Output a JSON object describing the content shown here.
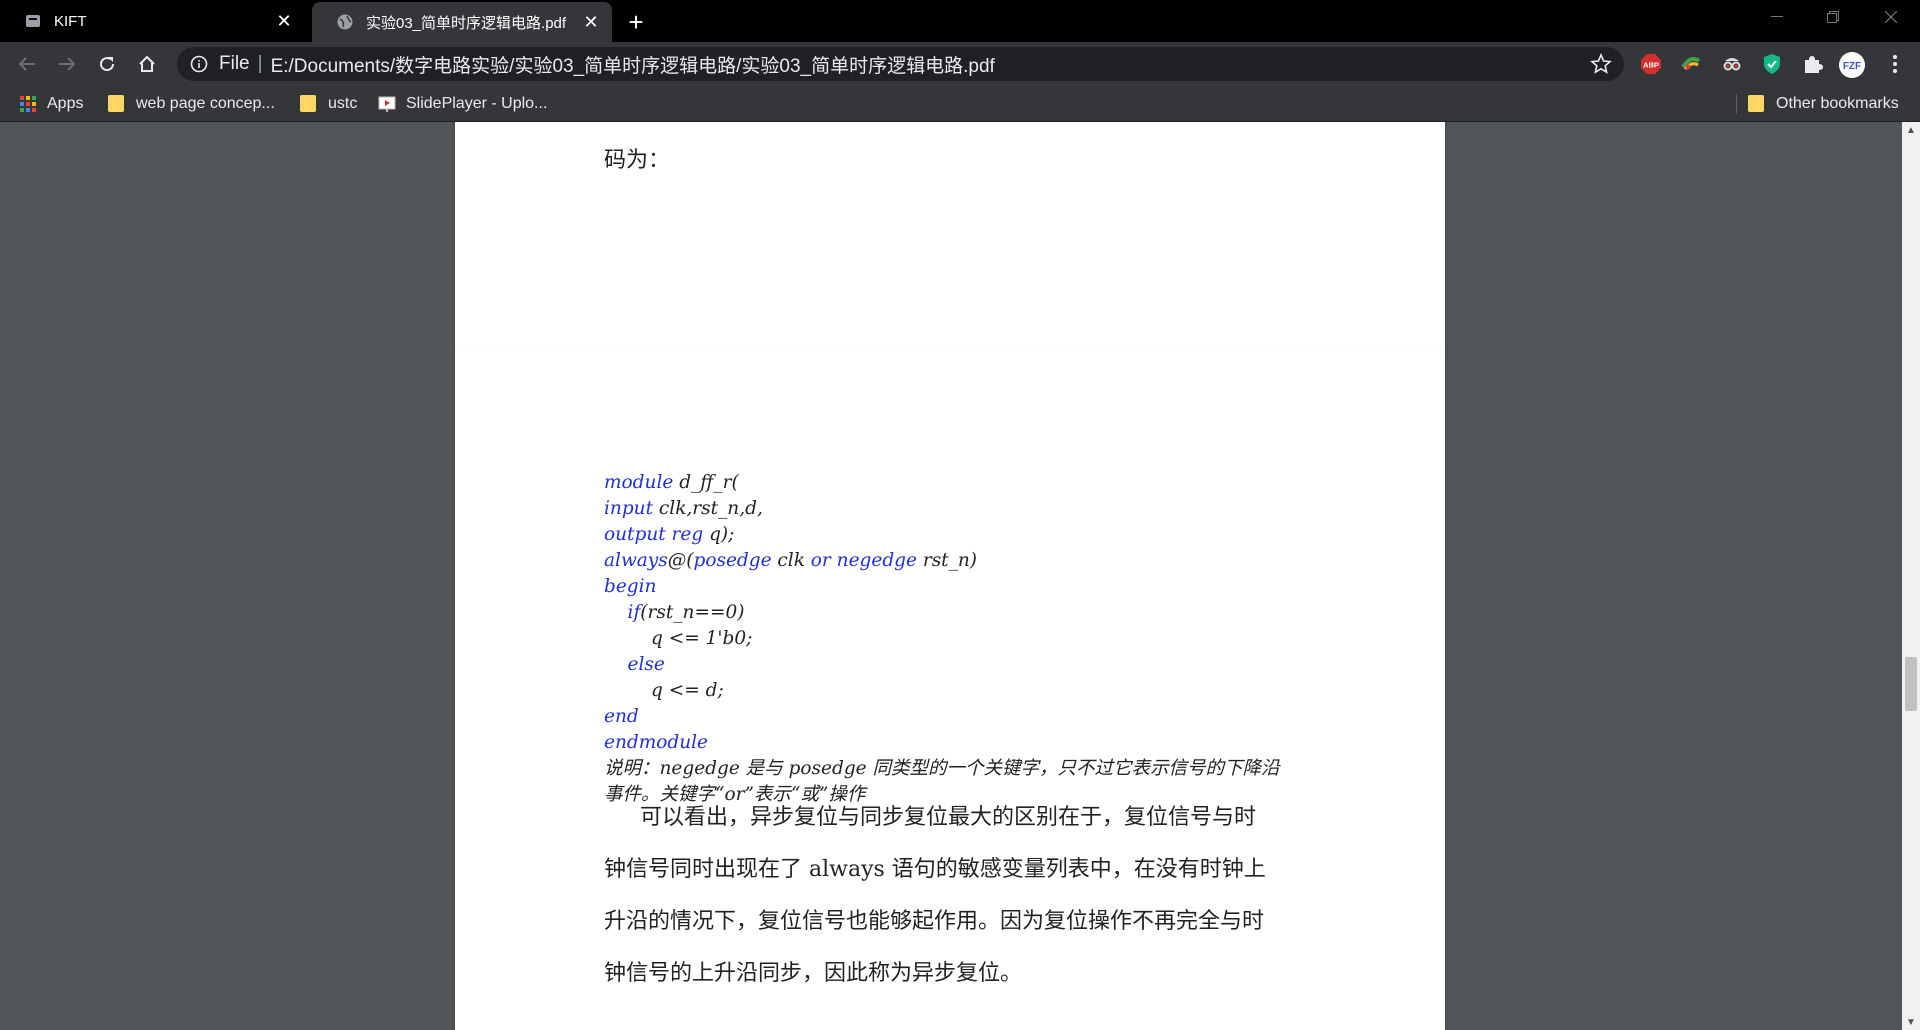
{
  "tabs": [
    {
      "title": "KIFT",
      "close": "✕"
    },
    {
      "title": "实验03_简单时序逻辑电路.pdf",
      "close": "✕"
    }
  ],
  "new_tab": "+",
  "omnibox": {
    "scheme": "File",
    "separator": "|",
    "url": "E:/Documents/数字电路实验/实验03_简单时序逻辑电路/实验03_简单时序逻辑电路.pdf"
  },
  "extensions": {
    "abp_label": "ABP",
    "profile_label": "FZF"
  },
  "bookmarks": [
    {
      "label": "Apps",
      "icon": "apps-grid-icon"
    },
    {
      "label": "web page concep...",
      "icon": "folder-icon"
    },
    {
      "label": "ustc",
      "icon": "folder-icon"
    },
    {
      "label": "SlidePlayer - Uplo...",
      "icon": "slideplayer-icon"
    }
  ],
  "other_bookmarks": "Other bookmarks",
  "pdf": {
    "page1_text": "码为：",
    "code_lines": [
      {
        "kw": "module",
        "rest": " d_ff_r("
      },
      {
        "kw": "input",
        "rest": " clk,rst_n,d,"
      },
      {
        "kw": "output reg",
        "rest": " q);"
      },
      {
        "kw": "always",
        "rest": "@(",
        "kw2": "posedge",
        "rest2": " clk ",
        "kw3": "or",
        "rest3": " ",
        "kw4": "negedge",
        "rest4": " rst_n)"
      },
      {
        "kw": "begin",
        "rest": ""
      },
      {
        "indent": "    ",
        "kw": "if",
        "rest": "(rst_n==0)"
      },
      {
        "indent": "        ",
        "kw": "",
        "rest": "q <= 1'b0;"
      },
      {
        "indent": "    ",
        "kw": "else",
        "rest": ""
      },
      {
        "indent": "        ",
        "kw": "",
        "rest": "q <= d;"
      },
      {
        "kw": "end",
        "rest": ""
      },
      {
        "kw": "endmodule",
        "rest": ""
      }
    ],
    "note_line1": "说明：negedge 是与 posedge 同类型的一个关键字，只不过它表示信号的下降沿",
    "note_line2": "事件。关键字“or”表示“或”操作",
    "para_lines": [
      "可以看出，异步复位与同步复位最大的区别在于，复位信号与时",
      "钟信号同时出现在了 always 语句的敏感变量列表中，在没有时钟上",
      "升沿的情况下，复位信号也能够起作用。因为复位操作不再完全与时",
      "钟信号的上升沿同步，因此称为异步复位。"
    ]
  },
  "colors": {
    "tabstrip": "#000000",
    "toolbar": "#35363a",
    "omnibox": "#202124",
    "viewer_bg": "#525659",
    "keyword": "#1f2fd1"
  }
}
